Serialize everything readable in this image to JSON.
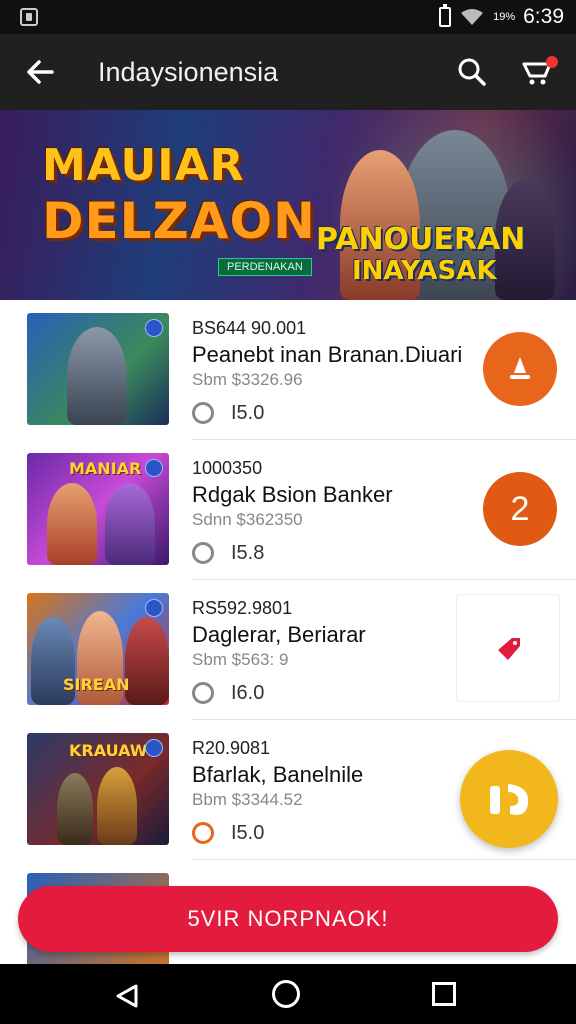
{
  "status_bar": {
    "time": "6:39",
    "battery_text": "19%"
  },
  "app_bar": {
    "title": "Indaysionensia"
  },
  "banner": {
    "title_line1": "MAUIAR",
    "title_line2": "DELZAON",
    "tag": "PERDENAKAN",
    "sub_line1": "PANOUERAN",
    "sub_line2": "INAYASAK"
  },
  "items": [
    {
      "code": "BS644 90.001",
      "name": "Peanebt inan Branan.Diuari",
      "price": "Sbm $3326.96",
      "rating": "I5.0",
      "thumb_text": "",
      "action_icon": "person-icon",
      "action_color": "#e8661c"
    },
    {
      "code": "1000350",
      "name": "Rdgak Bsion Banker",
      "price": "Sdnn $362350",
      "rating": "I5.8",
      "thumb_text": "MANIAR",
      "action_label": "2",
      "action_color": "#e05a14"
    },
    {
      "code": "RS592.9801",
      "name": "Daglerar, Beriarar",
      "price": "Sbm $563: 9",
      "rating": "I6.0",
      "thumb_text": "SIREAN",
      "action_icon": "tag-icon",
      "action_color": "#e31c3d"
    },
    {
      "code": "R20.9081",
      "name": "Bfarlak, Banelnile",
      "price": "Bbm $3344.52",
      "rating": "I5.0",
      "thumb_text": "KRAUAW",
      "action_icon": "headset-icon"
    }
  ],
  "cta": {
    "label": "5VIR NORPNAOK!"
  },
  "colors": {
    "accent": "#e31c3d",
    "fab": "#f2b71c",
    "appbar": "#202020"
  }
}
